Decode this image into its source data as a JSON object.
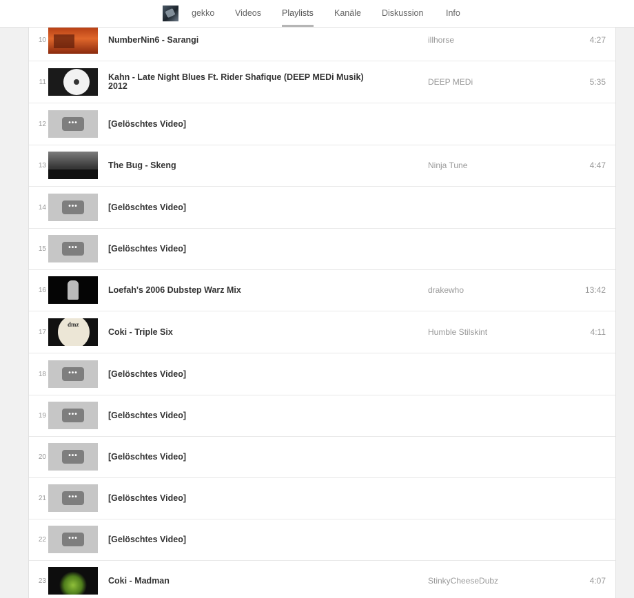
{
  "nav": {
    "channel_name": "gekko",
    "tabs": [
      "Videos",
      "Playlists",
      "Kanäle",
      "Diskussion",
      "Info"
    ],
    "active_tab": "Playlists"
  },
  "rows": [
    {
      "index": "10",
      "title": "NumberNin6 - Sarangi",
      "owner": "illhorse",
      "duration": "4:27",
      "thumb": "sarangi"
    },
    {
      "index": "11",
      "title": "Kahn - Late Night Blues Ft. Rider Shafique (DEEP MEDi Musik) 2012",
      "owner": "DEEP MEDi",
      "duration": "5:35",
      "thumb": "kahn"
    },
    {
      "index": "12",
      "title": "[Gelöschtes Video]",
      "owner": "",
      "duration": "",
      "thumb": "deleted"
    },
    {
      "index": "13",
      "title": "The Bug - Skeng",
      "owner": "Ninja Tune",
      "duration": "4:47",
      "thumb": "bug"
    },
    {
      "index": "14",
      "title": "[Gelöschtes Video]",
      "owner": "",
      "duration": "",
      "thumb": "deleted"
    },
    {
      "index": "15",
      "title": "[Gelöschtes Video]",
      "owner": "",
      "duration": "",
      "thumb": "deleted"
    },
    {
      "index": "16",
      "title": "Loefah's 2006 Dubstep Warz Mix",
      "owner": "drakewho",
      "duration": "13:42",
      "thumb": "loefah"
    },
    {
      "index": "17",
      "title": "Coki - Triple Six",
      "owner": "Humble Stilskint",
      "duration": "4:11",
      "thumb": "coki"
    },
    {
      "index": "18",
      "title": "[Gelöschtes Video]",
      "owner": "",
      "duration": "",
      "thumb": "deleted"
    },
    {
      "index": "19",
      "title": "[Gelöschtes Video]",
      "owner": "",
      "duration": "",
      "thumb": "deleted"
    },
    {
      "index": "20",
      "title": "[Gelöschtes Video]",
      "owner": "",
      "duration": "",
      "thumb": "deleted"
    },
    {
      "index": "21",
      "title": "[Gelöschtes Video]",
      "owner": "",
      "duration": "",
      "thumb": "deleted"
    },
    {
      "index": "22",
      "title": "[Gelöschtes Video]",
      "owner": "",
      "duration": "",
      "thumb": "deleted"
    },
    {
      "index": "23",
      "title": "Coki - Madman",
      "owner": "StinkyCheeseDubz",
      "duration": "4:07",
      "thumb": "madman"
    }
  ]
}
